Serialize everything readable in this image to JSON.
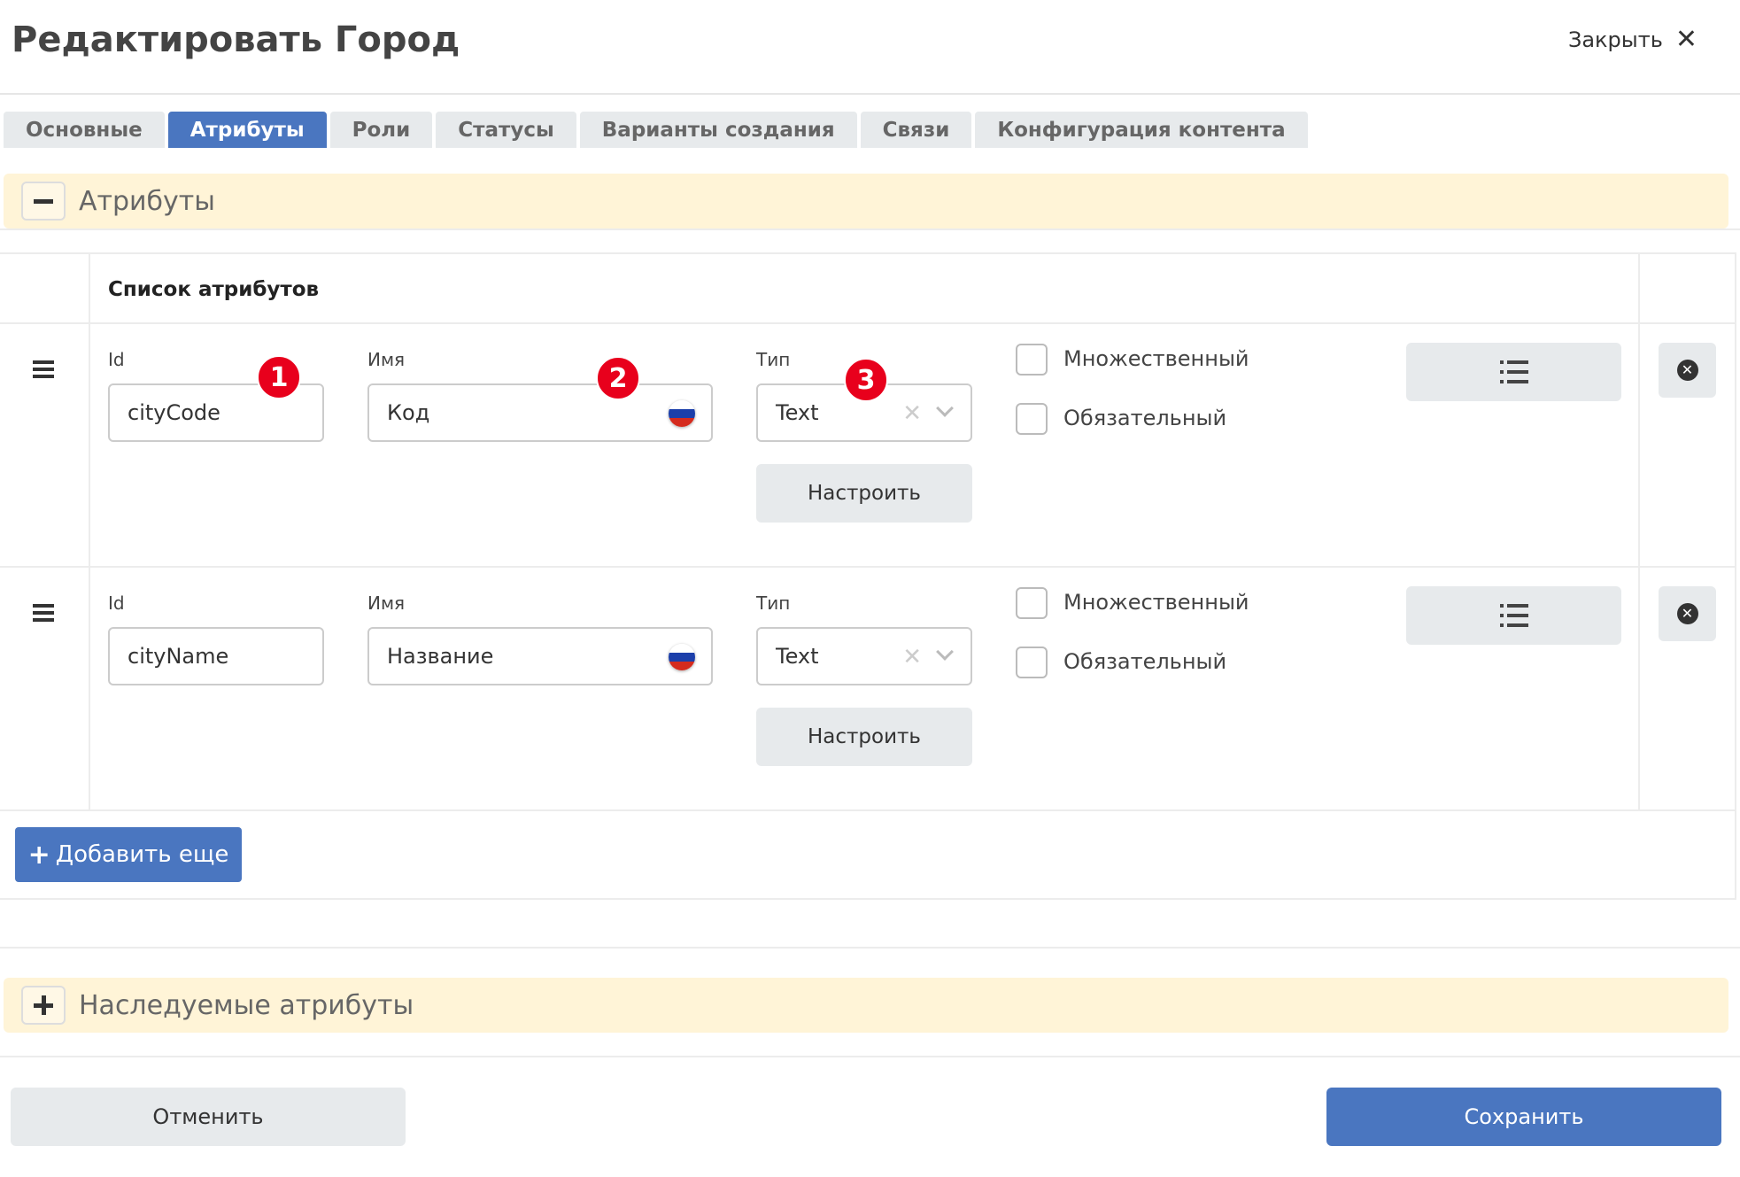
{
  "window": {
    "title": "Редактировать Город",
    "close_label": "Закрыть"
  },
  "tabs": [
    {
      "label": "Основные",
      "active": false
    },
    {
      "label": "Атрибуты",
      "active": true
    },
    {
      "label": "Роли",
      "active": false
    },
    {
      "label": "Статусы",
      "active": false
    },
    {
      "label": "Варианты создания",
      "active": false
    },
    {
      "label": "Связи",
      "active": false
    },
    {
      "label": "Конфигурация контента",
      "active": false
    }
  ],
  "attributes_section": {
    "label": "Атрибуты"
  },
  "attribute_list": {
    "title": "Список атрибутов",
    "rows": [
      {
        "id_label": "Id",
        "id_value": "cityCode",
        "name_label": "Имя",
        "name_value": "Код",
        "type_label": "Тип",
        "type_value": "Text",
        "configure_label": "Настроить",
        "multiple_label": "Множественный",
        "required_label": "Обязательный"
      },
      {
        "id_label": "Id",
        "id_value": "cityName",
        "name_label": "Имя",
        "name_value": "Название",
        "type_label": "Тип",
        "type_value": "Text",
        "configure_label": "Настроить",
        "multiple_label": "Множественный",
        "required_label": "Обязательный"
      }
    ],
    "add_label": "Добавить еще"
  },
  "annotations": [
    "1",
    "2",
    "3"
  ],
  "inherited_section": {
    "label": "Наследуемые атрибуты"
  },
  "footer": {
    "cancel_label": "Отменить",
    "save_label": "Сохранить"
  },
  "colors": {
    "accent": "#4a76c0",
    "section_bg": "#fff4d7",
    "badge": "#e8001c"
  }
}
